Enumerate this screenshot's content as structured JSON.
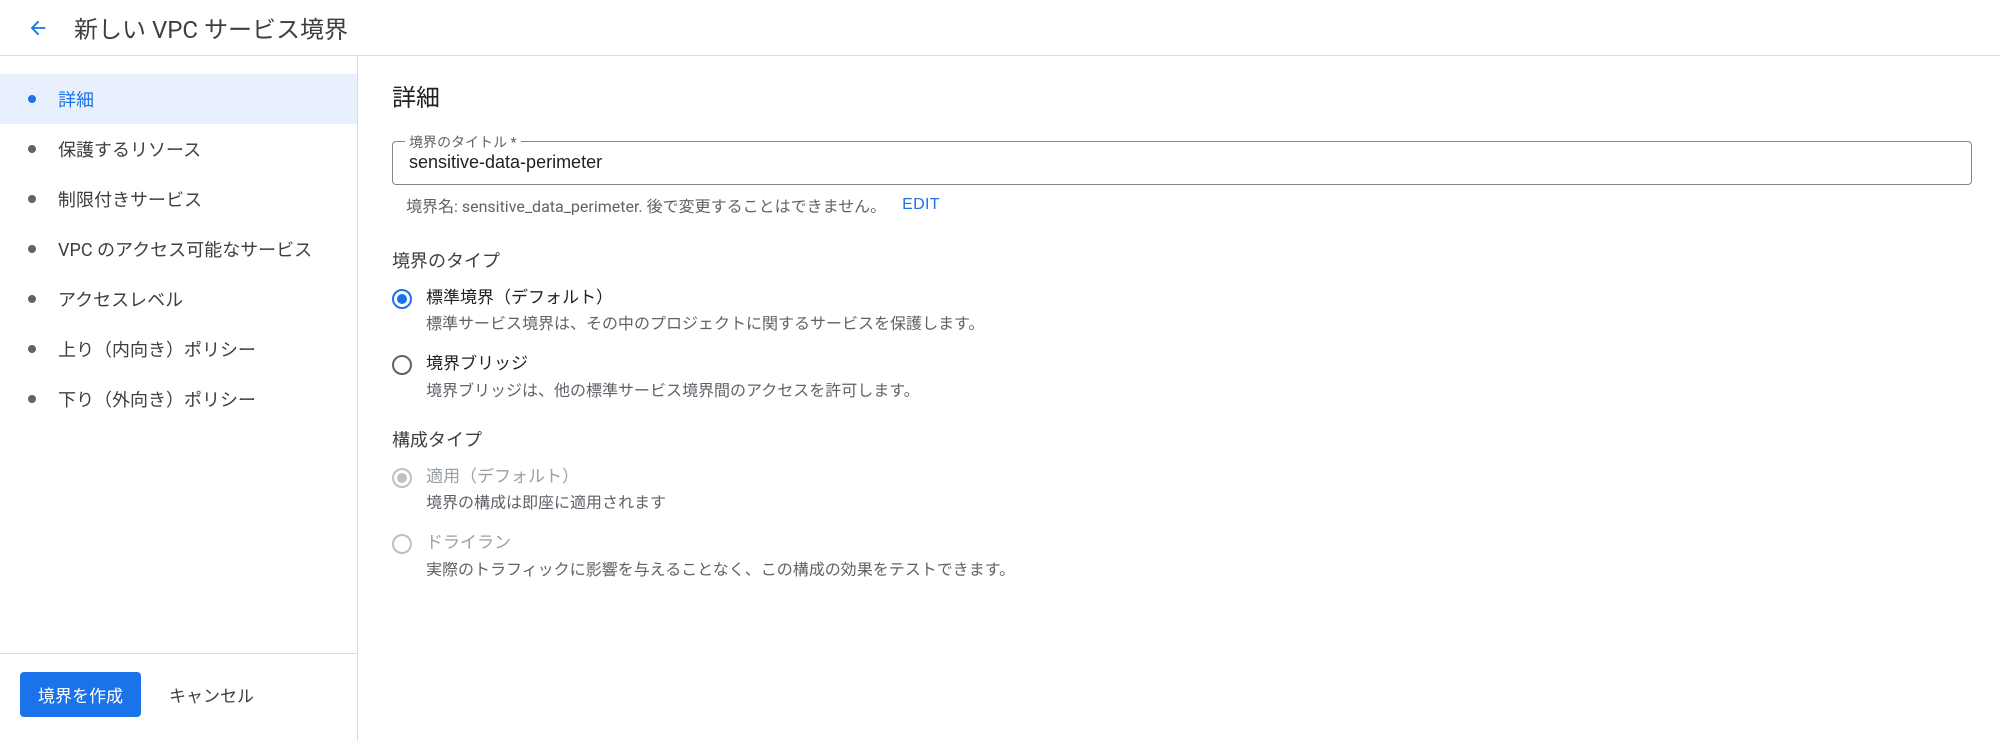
{
  "header": {
    "title": "新しい VPC サービス境界"
  },
  "sidebar": {
    "items": [
      {
        "label": "詳細",
        "active": true
      },
      {
        "label": "保護するリソース",
        "active": false
      },
      {
        "label": "制限付きサービス",
        "active": false
      },
      {
        "label": "VPC のアクセス可能なサービス",
        "active": false
      },
      {
        "label": "アクセスレベル",
        "active": false
      },
      {
        "label": "上り（内向き）ポリシー",
        "active": false
      },
      {
        "label": "下り（外向き）ポリシー",
        "active": false
      }
    ],
    "create_label": "境界を作成",
    "cancel_label": "キャンセル"
  },
  "main": {
    "section_title": "詳細",
    "title_field": {
      "label": "境界のタイトル *",
      "value": "sensitive-data-perimeter",
      "helper": "境界名: sensitive_data_perimeter. 後で変更することはできません。",
      "edit_label": "EDIT"
    },
    "perimeter_type": {
      "heading": "境界のタイプ",
      "options": [
        {
          "label": "標準境界（デフォルト）",
          "desc": "標準サービス境界は、その中のプロジェクトに関するサービスを保護します。",
          "selected": true,
          "disabled": false
        },
        {
          "label": "境界ブリッジ",
          "desc": "境界ブリッジは、他の標準サービス境界間のアクセスを許可します。",
          "selected": false,
          "disabled": false
        }
      ]
    },
    "config_type": {
      "heading": "構成タイプ",
      "options": [
        {
          "label": "適用（デフォルト）",
          "desc": "境界の構成は即座に適用されます",
          "selected": true,
          "disabled": true
        },
        {
          "label": "ドライラン",
          "desc": "実際のトラフィックに影響を与えることなく、この構成の効果をテストできます。",
          "selected": false,
          "disabled": true
        }
      ]
    }
  }
}
